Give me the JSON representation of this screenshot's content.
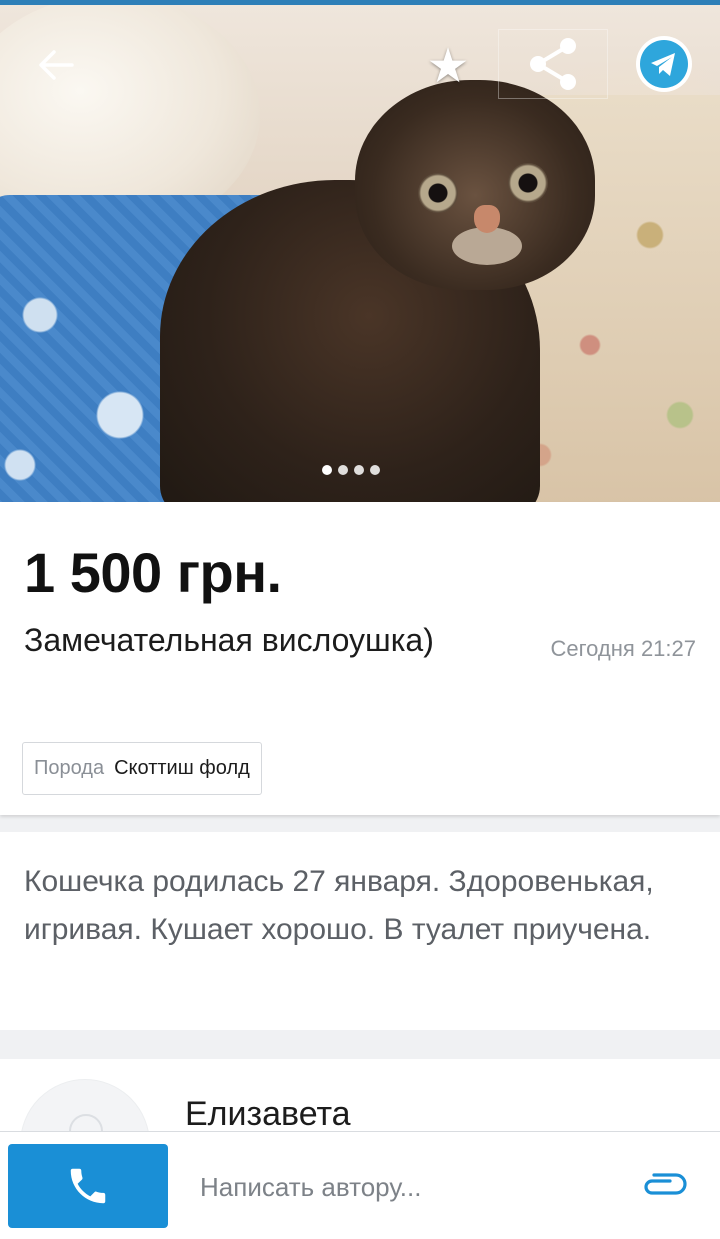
{
  "photo": {
    "back_icon": "arrow-left-icon",
    "favorite_icon": "star-icon",
    "share_icon": "share-icon",
    "telegram_icon": "telegram-icon",
    "pager": {
      "total": 4,
      "current": 1
    }
  },
  "listing": {
    "price": "1 500 грн.",
    "title": "Замечательная вислоушка)",
    "date": "Сегодня 21:27",
    "attributes": [
      {
        "key": "Порода",
        "value": "Скоттиш фолд"
      }
    ],
    "description": "Кошечка родилась 27 января. Здоровенькая, игривая. Кушает хорошо. В туалет приучена."
  },
  "author": {
    "name": "Елизавета"
  },
  "bottom_bar": {
    "call_icon": "phone-icon",
    "message_placeholder": "Написать автору...",
    "attach_icon": "paperclip-icon"
  },
  "colors": {
    "accent": "#1a8fd6",
    "top_line": "#2e7fb8"
  }
}
